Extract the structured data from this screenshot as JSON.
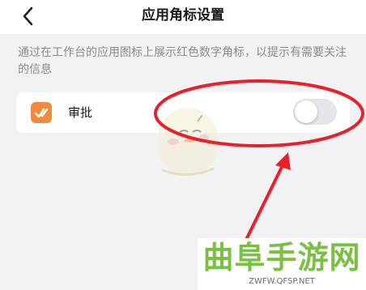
{
  "header": {
    "title": "应用角标设置"
  },
  "settings": {
    "description": "通过在工作台的应用图标上展示红色数字角标，以提示有需要关注的信息",
    "rows": [
      {
        "label": "审批",
        "icon": "approval-check-icon",
        "enabled": false
      }
    ]
  },
  "watermark": {
    "title": "曲阜手游网",
    "url": "ZWFW.QFSP.NET"
  },
  "colors": {
    "annotation_red": "#e8202a",
    "app_icon_orange": "#f08a3c",
    "watermark_green": "#7ac143"
  }
}
